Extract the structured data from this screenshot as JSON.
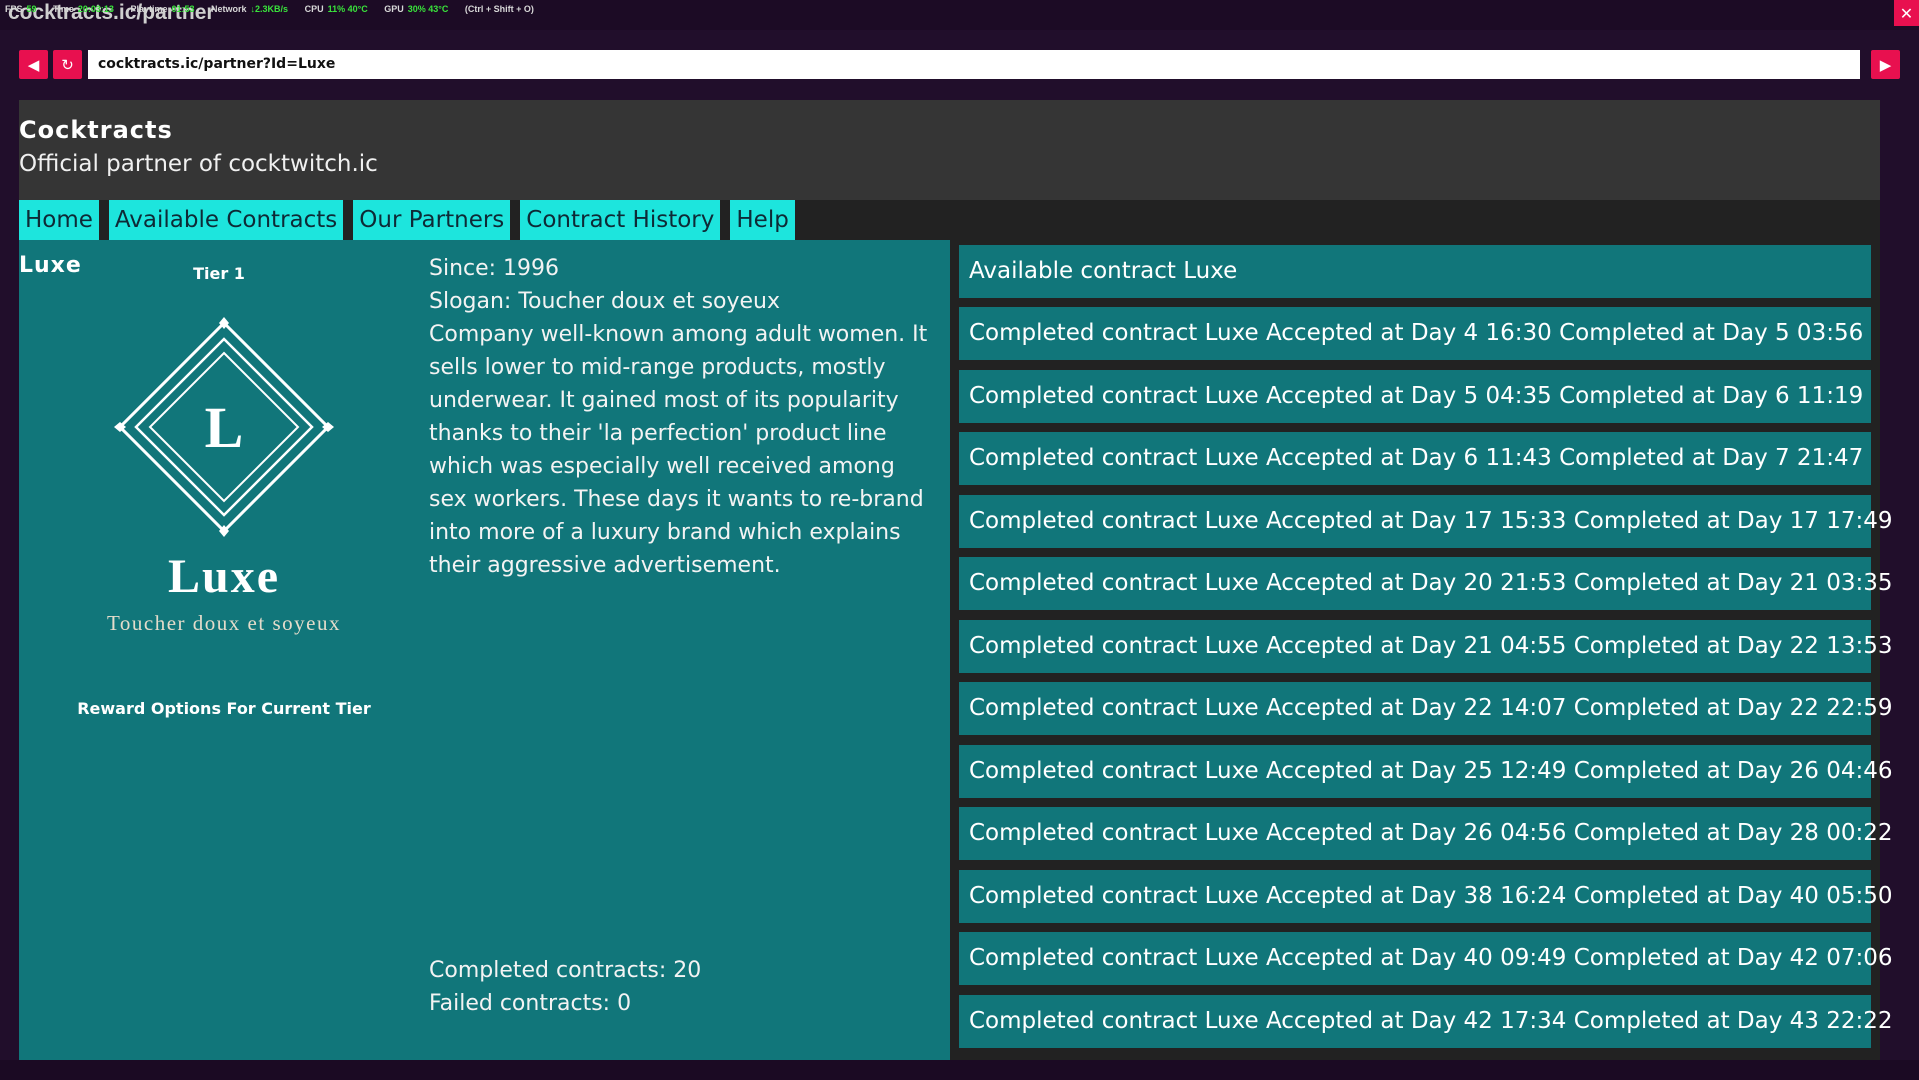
{
  "window": {
    "title": "cocktracts.ic/partner",
    "close_glyph": "✕"
  },
  "overlay": {
    "fps_label": "FPS",
    "fps_value": "59",
    "time_label": "Time",
    "time_value": "20:03:13",
    "playtime_label": "Playtime",
    "playtime_value": "01:53",
    "network_label": "Network",
    "network_value": "↓2.3KB/s",
    "cpu_label": "CPU",
    "cpu_value": "11%  40°C",
    "gpu_label": "GPU",
    "gpu_value": "30%  43°C",
    "shortcut": "(Ctrl + Shift + O)"
  },
  "browser": {
    "back_icon": "◀",
    "reload_icon": "↻",
    "forward_icon": "▶",
    "url": "cocktracts.ic/partner?Id=Luxe"
  },
  "site": {
    "name": "Cocktracts",
    "tagline": "Official partner of cocktwitch.ic"
  },
  "nav": {
    "home": "Home",
    "available": "Available Contracts",
    "partners": "Our Partners",
    "history": "Contract History",
    "help": "Help"
  },
  "partner": {
    "name": "Luxe",
    "tier": "Tier 1",
    "logo_letter": "L",
    "logo_name": "Luxe",
    "logo_slogan": "Toucher doux et soyeux",
    "reward_label": "Reward Options For Current Tier",
    "since": "Since: 1996",
    "slogan": "Slogan: Toucher doux et soyeux",
    "description": "Company well-known among adult women. It sells lower to mid-range products, mostly underwear. It gained most of its popularity thanks to their 'la perfection' product line which was especially well received among sex workers. These days it wants to re-brand into more of a luxury brand which explains their aggressive advertisement.",
    "completed": "Completed contracts: 20",
    "failed": "Failed contracts: 0"
  },
  "contracts": [
    "Available contract Luxe",
    "Completed contract Luxe Accepted at Day 4 16:30 Completed at Day 5 03:56",
    "Completed contract Luxe Accepted at Day 5 04:35 Completed at Day 6 11:19",
    "Completed contract Luxe Accepted at Day 6 11:43 Completed at Day 7 21:47",
    "Completed contract Luxe Accepted at Day 17 15:33 Completed at Day 17 17:49",
    "Completed contract Luxe Accepted at Day 20 21:53 Completed at Day 21 03:35",
    "Completed contract Luxe Accepted at Day 21 04:55 Completed at Day 22 13:53",
    "Completed contract Luxe Accepted at Day 22 14:07 Completed at Day 22 22:59",
    "Completed contract Luxe Accepted at Day 25 12:49 Completed at Day 26 04:46",
    "Completed contract Luxe Accepted at Day 26 04:56 Completed at Day 28 00:22",
    "Completed contract Luxe Accepted at Day 38 16:24 Completed at Day 40 05:50",
    "Completed contract Luxe Accepted at Day 40 09:49 Completed at Day 42 07:06",
    "Completed contract Luxe Accepted at Day 42 17:34 Completed at Day 43 22:22"
  ],
  "colors": {
    "accent": "#e8104f",
    "teal_panel": "#11767a",
    "nav_cyan": "#1de5dd",
    "background": "#210e2b"
  }
}
